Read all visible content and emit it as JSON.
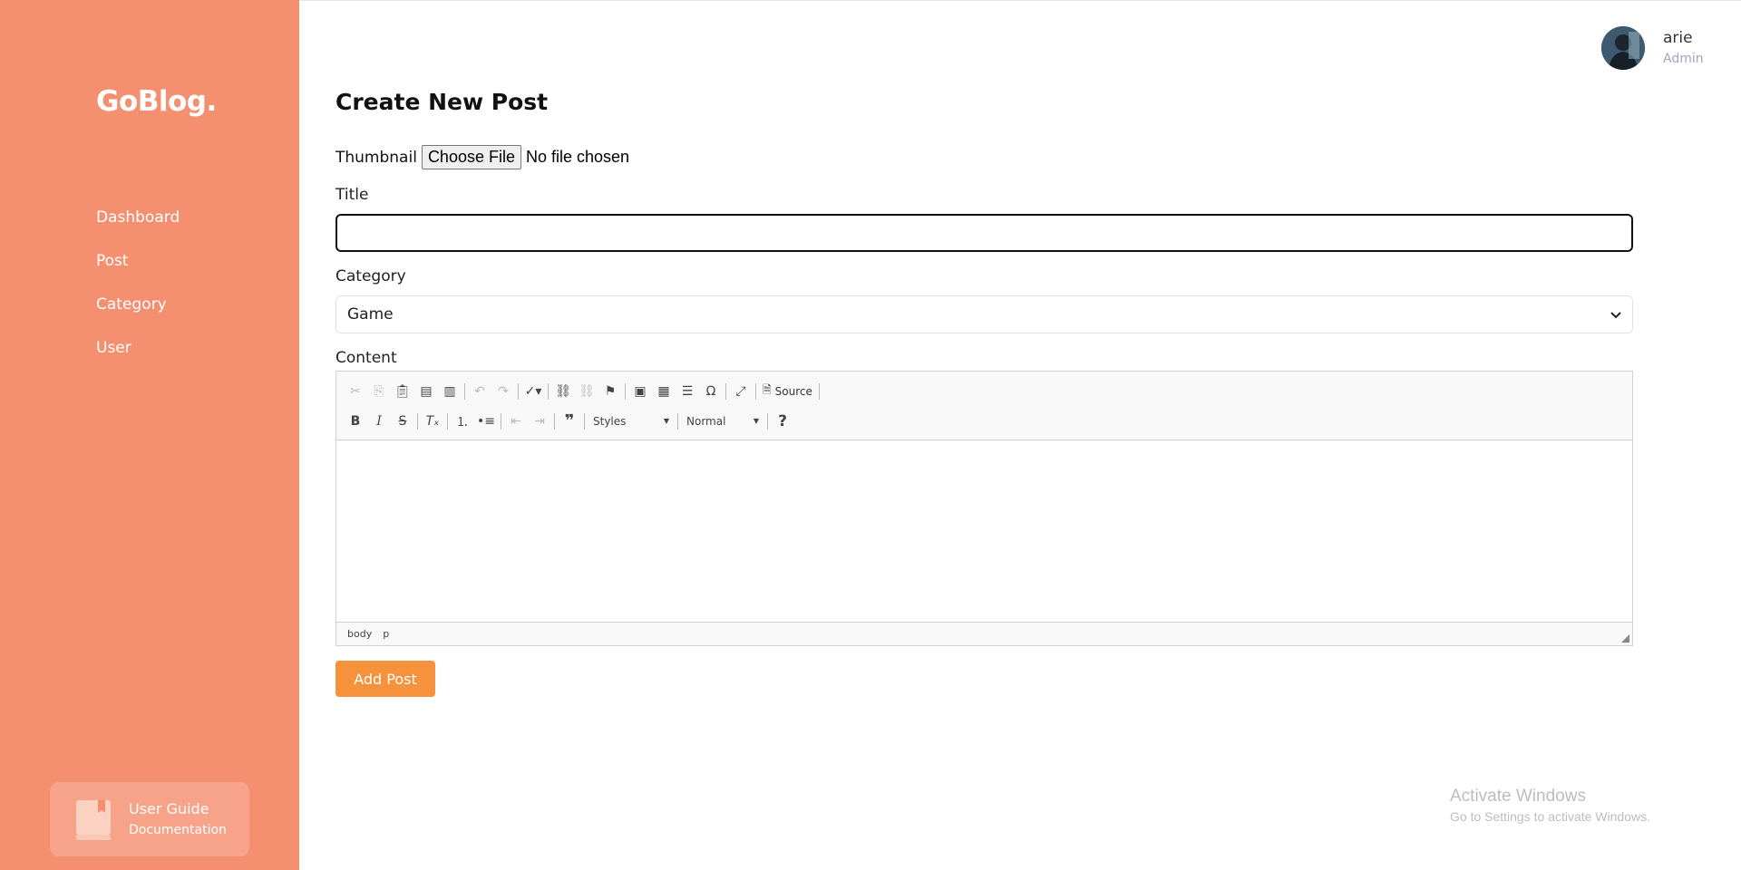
{
  "sidebar": {
    "brand": "GoBlog.",
    "items": [
      {
        "label": "Dashboard"
      },
      {
        "label": "Post"
      },
      {
        "label": "Category"
      },
      {
        "label": "User"
      }
    ],
    "guide": {
      "title": "User Guide",
      "subtitle": "Documentation"
    }
  },
  "user": {
    "name": "arie",
    "role": "Admin"
  },
  "page": {
    "title": "Create New Post"
  },
  "form": {
    "thumbnail_label": "Thumbnail",
    "file_button": "Choose File",
    "file_status": "No file chosen",
    "title_label": "Title",
    "title_value": "",
    "category_label": "Category",
    "category_value": "Game",
    "content_label": "Content",
    "submit_label": "Add Post"
  },
  "editor": {
    "source_label": "Source",
    "styles_combo": "Styles",
    "format_combo": "Normal",
    "status_path": [
      "body",
      "p"
    ]
  },
  "watermark": {
    "line1": "Activate Windows",
    "line2": "Go to Settings to activate Windows."
  },
  "colors": {
    "sidebar": "#f48f70",
    "accent": "#f7923c"
  }
}
